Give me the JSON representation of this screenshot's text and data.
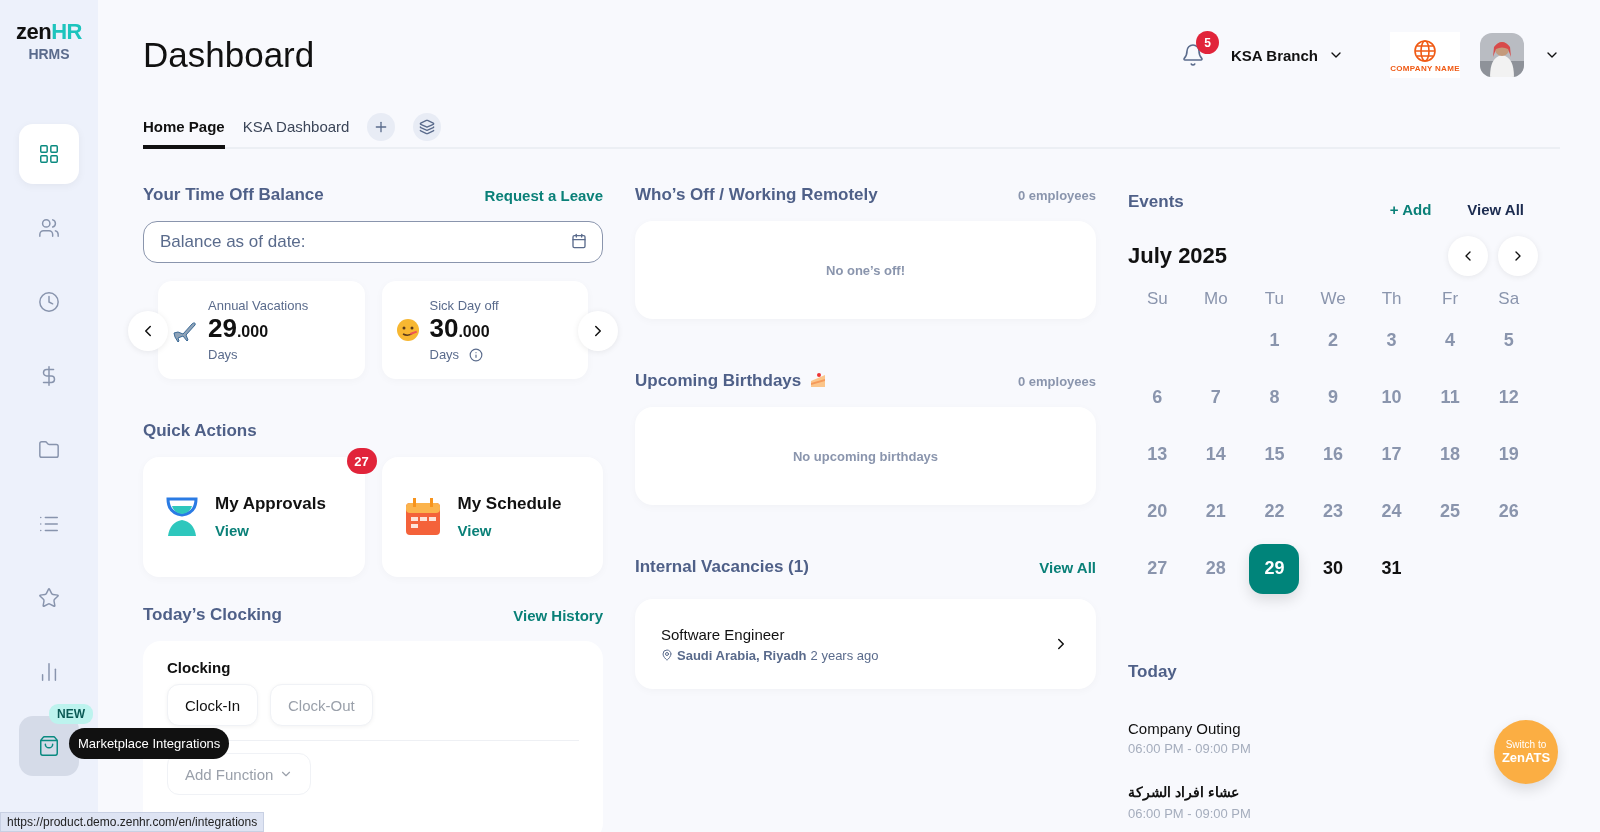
{
  "sidebar": {
    "logo": {
      "word": "zen",
      "accent": "HR",
      "product": "HRMS"
    },
    "items": [
      {
        "selected": true,
        "hovered": false
      },
      {
        "selected": false,
        "hovered": false
      },
      {
        "selected": false,
        "hovered": false
      },
      {
        "selected": false,
        "hovered": false
      },
      {
        "selected": false,
        "hovered": false
      },
      {
        "selected": false,
        "hovered": false
      },
      {
        "selected": false,
        "hovered": false
      },
      {
        "selected": false,
        "hovered": false
      },
      {
        "selected": false,
        "hovered": true,
        "badge": "NEW",
        "tooltip": "Marketplace Integrations"
      }
    ]
  },
  "header": {
    "title": "Dashboard",
    "notifications": "5",
    "branch": "KSA Branch",
    "company_logo": "COMPANY NAME"
  },
  "tabs": [
    {
      "label": "Home Page",
      "selected": true
    },
    {
      "label": "KSA Dashboard",
      "selected": false
    }
  ],
  "time_off": {
    "title": "Your Time Off Balance",
    "action": "Request a Leave",
    "date_field": {
      "placeholder": "Balance as of date:"
    },
    "balances": [
      {
        "kind": "plane",
        "name": "Annual Vacations",
        "whole": "29",
        "fraction": ".000",
        "unit": "Days",
        "info": false
      },
      {
        "kind": "face",
        "name": "Sick Day off",
        "whole": "30",
        "fraction": ".000",
        "unit": "Days",
        "info": true
      }
    ]
  },
  "quick_actions": {
    "title": "Quick Actions",
    "items": [
      {
        "kind": "hourglass",
        "title": "My Approvals",
        "link": "View",
        "badge": "27"
      },
      {
        "kind": "calendar",
        "title": "My Schedule",
        "link": "View"
      }
    ]
  },
  "clocking": {
    "title": "Today’s Clocking",
    "action": "View History",
    "card_title": "Clocking",
    "buttons": [
      {
        "label": "Clock-In",
        "disabled": false
      },
      {
        "label": "Clock-Out",
        "disabled": true
      }
    ],
    "add_function": "Add Function"
  },
  "whos_off": {
    "title": "Who’s Off / Working Remotely",
    "count": "0 employees",
    "empty": "No one’s off!"
  },
  "birthdays": {
    "title": "Upcoming Birthdays",
    "count": "0 employees",
    "empty": "No upcoming birthdays"
  },
  "vacancies": {
    "title": "Internal Vacancies (1)",
    "action": "View All",
    "items": [
      {
        "title": "Software Engineer",
        "location": "Saudi Arabia, Riyadh",
        "age": "2 years ago"
      }
    ]
  },
  "calendar": {
    "title": "Events",
    "add": "+ Add",
    "view_all": "View All",
    "month": "July 2025",
    "weekdays": [
      "Su",
      "Mo",
      "Tu",
      "We",
      "Th",
      "Fr",
      "Sa"
    ],
    "weeks": [
      [
        {
          "label": "1",
          "past": true,
          "selected": false
        },
        {
          "label": "2",
          "past": true,
          "selected": false
        },
        {
          "label": "3",
          "past": true,
          "selected": false
        },
        {
          "label": "4",
          "past": true,
          "selected": false
        },
        {
          "label": "5",
          "past": true,
          "selected": false
        }
      ],
      [
        {
          "label": "6",
          "past": true,
          "selected": false
        },
        {
          "label": "7",
          "past": true,
          "selected": false
        },
        {
          "label": "8",
          "past": true,
          "selected": false
        },
        {
          "label": "9",
          "past": true,
          "selected": false
        },
        {
          "label": "10",
          "past": true,
          "selected": false
        },
        {
          "label": "11",
          "past": true,
          "selected": false
        },
        {
          "label": "12",
          "past": true,
          "selected": false
        }
      ],
      [
        {
          "label": "13",
          "past": true,
          "selected": false
        },
        {
          "label": "14",
          "past": true,
          "selected": false
        },
        {
          "label": "15",
          "past": true,
          "selected": false
        },
        {
          "label": "16",
          "past": true,
          "selected": false
        },
        {
          "label": "17",
          "past": true,
          "selected": false
        },
        {
          "label": "18",
          "past": true,
          "selected": false
        },
        {
          "label": "19",
          "past": true,
          "selected": false
        }
      ],
      [
        {
          "label": "20",
          "past": true,
          "selected": false
        },
        {
          "label": "21",
          "past": true,
          "selected": false
        },
        {
          "label": "22",
          "past": true,
          "selected": false
        },
        {
          "label": "23",
          "past": true,
          "selected": false
        },
        {
          "label": "24",
          "past": true,
          "selected": false
        },
        {
          "label": "25",
          "past": true,
          "selected": false
        },
        {
          "label": "26",
          "past": true,
          "selected": false
        }
      ],
      [
        {
          "label": "27",
          "past": true,
          "selected": false
        },
        {
          "label": "28",
          "past": true,
          "selected": false
        },
        {
          "label": "29",
          "past": false,
          "selected": true
        },
        {
          "label": "30",
          "past": false,
          "selected": false
        },
        {
          "label": "31",
          "past": false,
          "selected": false
        }
      ]
    ],
    "today_title": "Today",
    "events": [
      {
        "title": "Company Outing",
        "time": "06:00 PM - 09:00 PM",
        "rtl": false
      },
      {
        "title": "عشاء افراد الشركة",
        "time": "06:00 PM - 09:00 PM",
        "rtl": true
      }
    ]
  },
  "switch_button": {
    "line1": "Switch to",
    "line2": "ZenATS"
  },
  "status_bar": {
    "url": "https://product.demo.zenhr.com/en/integrations"
  }
}
